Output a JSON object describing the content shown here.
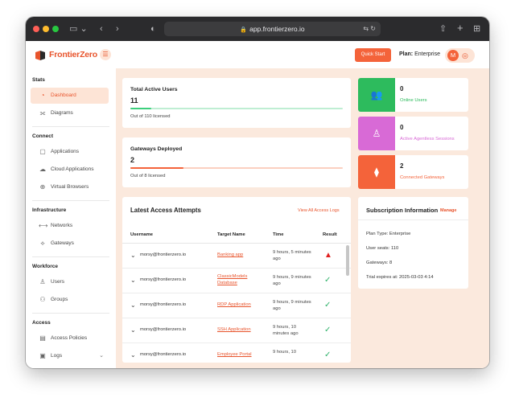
{
  "browser": {
    "url": "app.frontierzero.io"
  },
  "header": {
    "brand": "FrontierZero",
    "quick_start": "Quick Start",
    "plan_label": "Plan:",
    "plan_value": "Enterprise",
    "avatar_initial": "M"
  },
  "sidebar": {
    "sections": [
      {
        "title": "Stats",
        "items": [
          {
            "label": "Dashboard",
            "icon": "dashboard-icon",
            "active": true
          },
          {
            "label": "Diagrams",
            "icon": "diagram-icon"
          }
        ]
      },
      {
        "title": "Connect",
        "items": [
          {
            "label": "Applications",
            "icon": "application-icon"
          },
          {
            "label": "Cloud Applications",
            "icon": "cloud-icon"
          },
          {
            "label": "Virtual Browsers",
            "icon": "globe-icon"
          }
        ]
      },
      {
        "title": "Infrastructure",
        "items": [
          {
            "label": "Networks",
            "icon": "network-icon"
          },
          {
            "label": "Gateways",
            "icon": "gateway-icon"
          }
        ]
      },
      {
        "title": "Workforce",
        "items": [
          {
            "label": "Users",
            "icon": "user-icon"
          },
          {
            "label": "Groups",
            "icon": "group-icon"
          }
        ]
      },
      {
        "title": "Access",
        "items": [
          {
            "label": "Access Policies",
            "icon": "policy-icon"
          },
          {
            "label": "Logs",
            "icon": "logs-icon"
          }
        ]
      }
    ]
  },
  "cards": {
    "active_users": {
      "title": "Total Active Users",
      "value": "11",
      "sub": "Out of 110 licensed",
      "progress": 0.1,
      "color": "#3ccf7c"
    },
    "gateways": {
      "title": "Gateways Deployed",
      "value": "2",
      "sub": "Out of 8 licensed",
      "progress": 0.25,
      "color": "#f4633a"
    }
  },
  "stats": [
    {
      "value": "0",
      "label": "Online Users",
      "color": "#2dbb5d",
      "icon": "users-icon"
    },
    {
      "value": "0",
      "label": "Active Agentless Sessions",
      "color": "#d86ad6",
      "icon": "session-user-icon"
    },
    {
      "value": "2",
      "label": "Connected Gateways",
      "color": "#f4633a",
      "icon": "gateway-icon"
    }
  ],
  "attempts": {
    "title": "Latest Access Attempts",
    "view_all": "View All Access Logs",
    "columns": [
      "Username",
      "Target Name",
      "Time",
      "Result"
    ],
    "rows": [
      {
        "user": "morsy@frontierzero.io",
        "target": "Banking app",
        "time": "9 hours, 5 minutes ago",
        "result": "warning"
      },
      {
        "user": "morsy@frontierzero.io",
        "target": "ClassicModels Database",
        "time": "9 hours, 9 minutes ago",
        "result": "success"
      },
      {
        "user": "morsy@frontierzero.io",
        "target": "RDP Application",
        "time": "9 hours, 9 minutes ago",
        "result": "success"
      },
      {
        "user": "morsy@frontierzero.io",
        "target": "SSH Application",
        "time": "9 hours, 10 minutes ago",
        "result": "success"
      },
      {
        "user": "morsy@frontierzero.io",
        "target": "Employee Portal",
        "time": "9 hours, 10",
        "result": "success"
      }
    ]
  },
  "subscription": {
    "title": "Subscription Information",
    "manage": "Manage",
    "plan_type_label": "Plan Type:",
    "plan_type": "Enterprise",
    "seats_label": "User seats:",
    "seats": "110",
    "gateways_label": "Gateways:",
    "gateways": "8",
    "trial_label": "Trial expires at:",
    "trial": "2025-03-03 4:14"
  }
}
